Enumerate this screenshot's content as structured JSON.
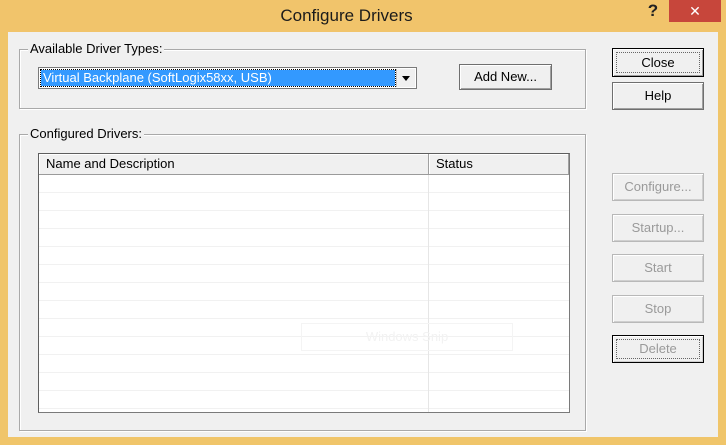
{
  "window": {
    "title": "Configure Drivers",
    "help_glyph": "?",
    "close_glyph": "✕"
  },
  "available": {
    "group_label": "Available Driver Types:",
    "selected_value": "Virtual Backplane (SoftLogix58xx, USB)",
    "add_new_label": "Add New..."
  },
  "configured": {
    "group_label": "Configured Drivers:",
    "columns": [
      "Name and Description",
      "Status"
    ],
    "rows": []
  },
  "buttons": {
    "close": "Close",
    "help": "Help",
    "configure": "Configure...",
    "startup": "Startup...",
    "start": "Start",
    "stop": "Stop",
    "delete": "Delete"
  },
  "watermark": "Windows Snip",
  "colors": {
    "titlebar": "#f1c46b",
    "close_button": "#c7463b",
    "selection": "#3399ff",
    "dialog_face": "#f0f0f0"
  }
}
